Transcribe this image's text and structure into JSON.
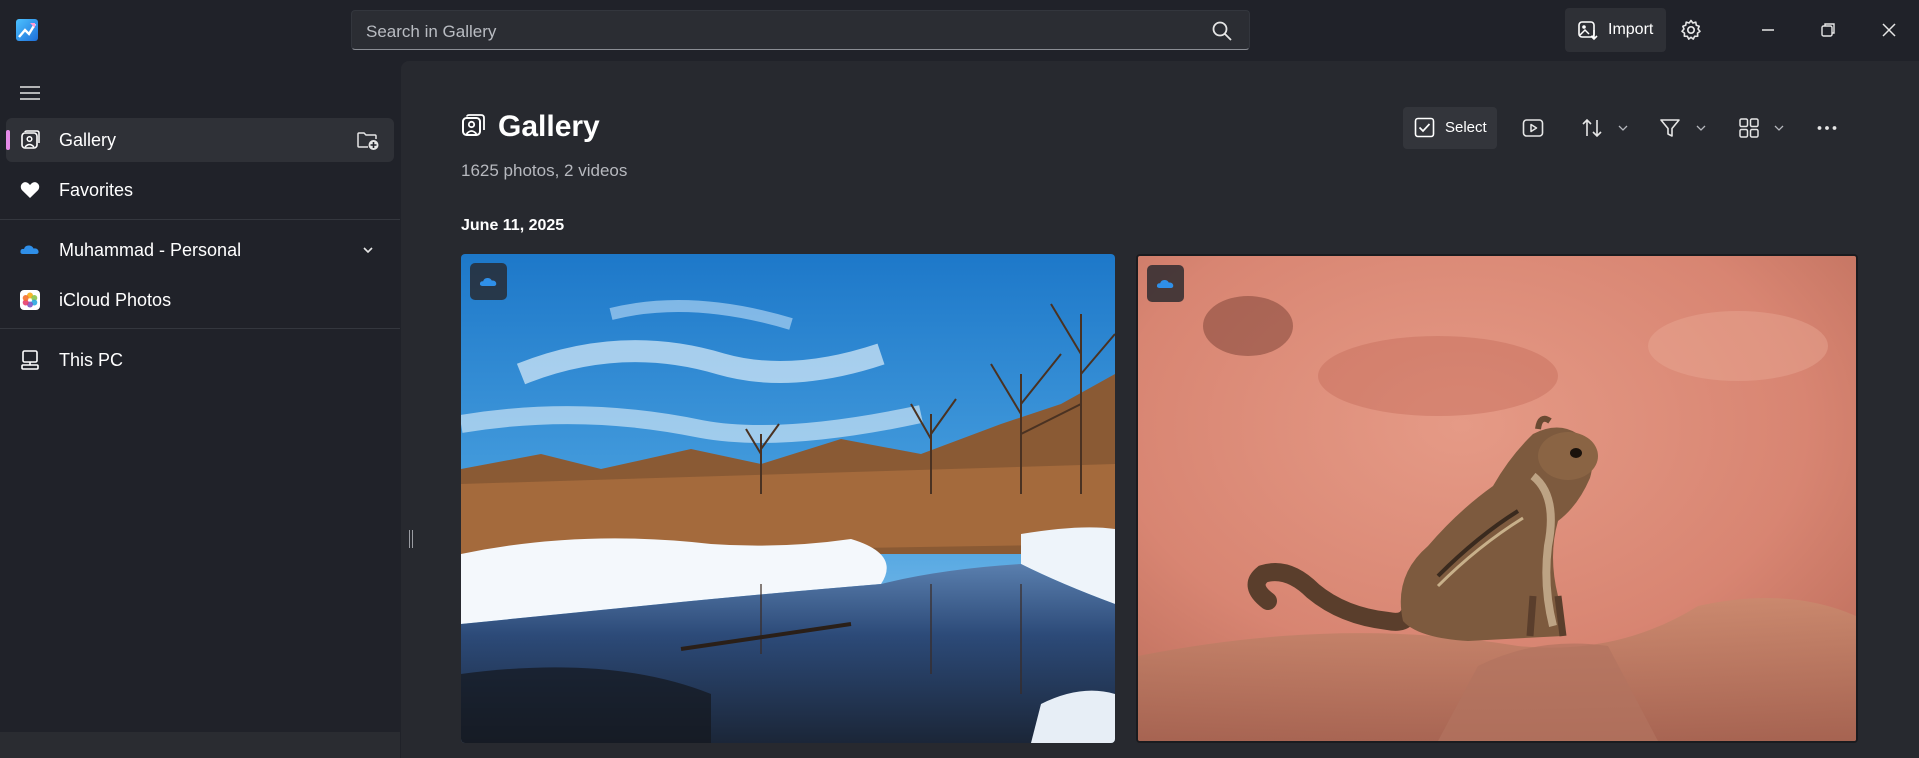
{
  "search": {
    "placeholder": "Search in Gallery"
  },
  "titlebar": {
    "import_label": "Import"
  },
  "sidebar": {
    "items": [
      {
        "label": "Gallery",
        "icon": "gallery-icon"
      },
      {
        "label": "Favorites",
        "icon": "heart-icon"
      },
      {
        "label": "Muhammad - Personal",
        "icon": "onedrive-cloud-icon"
      },
      {
        "label": "iCloud Photos",
        "icon": "icloud-photos-icon"
      },
      {
        "label": "This PC",
        "icon": "computer-icon"
      }
    ]
  },
  "main": {
    "title": "Gallery",
    "subtitle": "1625 photos, 2 videos",
    "toolbar": {
      "select_label": "Select"
    },
    "groups": [
      {
        "date": "June 11, 2025",
        "photos": [
          {
            "name": "winter-river-landscape",
            "cloud_icon": "onedrive-cloud-icon"
          },
          {
            "name": "squirrel-on-rock",
            "cloud_icon": "onedrive-cloud-icon"
          }
        ]
      }
    ]
  },
  "colors": {
    "accent": "#e58ae8",
    "background": "#202229",
    "panel": "#27292f",
    "onedrive": "#2f8fe8"
  }
}
